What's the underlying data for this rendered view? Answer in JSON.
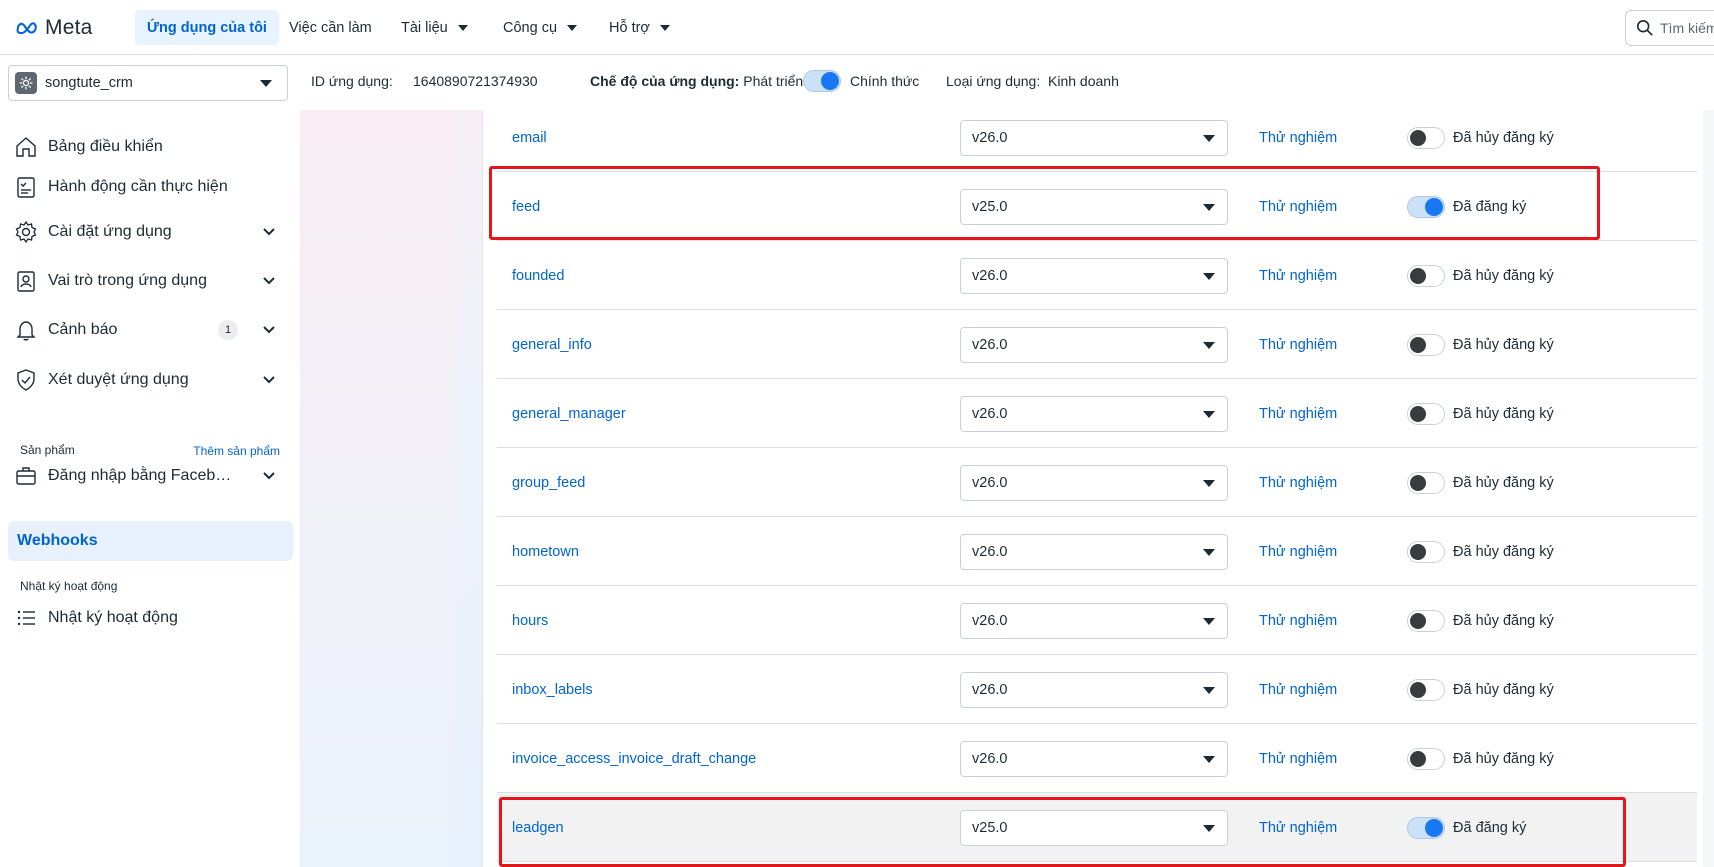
{
  "brand": {
    "name": "Meta"
  },
  "topnav": {
    "tabs": [
      {
        "label": "Ứng dụng của tôi",
        "active": true,
        "dropdown": false
      },
      {
        "label": "Việc cần làm",
        "active": false,
        "dropdown": false
      },
      {
        "label": "Tài liệu",
        "active": false,
        "dropdown": true
      },
      {
        "label": "Công cụ",
        "active": false,
        "dropdown": true
      },
      {
        "label": "Hỗ trợ",
        "active": false,
        "dropdown": true
      }
    ],
    "search_placeholder": "Tìm kiếm"
  },
  "appbar": {
    "app_name": "songtute_crm",
    "app_id_label": "ID ứng dụng:",
    "app_id": "1640890721374930",
    "mode_label": "Chế độ của ứng dụng:",
    "mode_dev": "Phát triển",
    "mode_live": "Chính thức",
    "mode_live_on": true,
    "type_label": "Loại ứng dụng:",
    "type_value": "Kinh doanh"
  },
  "sidebar": {
    "items": [
      {
        "label": "Bảng điều khiển",
        "icon": "home-icon"
      },
      {
        "label": "Hành động cần thực hiện",
        "icon": "checklist-icon"
      },
      {
        "label": "Cài đặt ứng dụng",
        "icon": "gear-icon"
      },
      {
        "label": "Vai trò trong ứng dụng",
        "icon": "id-badge-icon"
      },
      {
        "label": "Cảnh báo",
        "icon": "bell-icon",
        "badge": "1"
      },
      {
        "label": "Xét duyệt ứng dụng",
        "icon": "shield-check-icon"
      }
    ],
    "products_heading": "Sản phẩm",
    "add_product": "Thêm sản phẩm",
    "product_item": "Đăng nhập bằng Faceb…",
    "webhooks": "Webhooks",
    "activity_heading": "Nhật ký hoạt động",
    "activity_item": "Nhật ký hoạt động"
  },
  "fields": [
    {
      "name": "email",
      "version": "v26.0",
      "test": "Thử nghiệm",
      "subscribed": false,
      "status": "Đã hủy đăng ký"
    },
    {
      "name": "feed",
      "version": "v25.0",
      "test": "Thử nghiệm",
      "subscribed": true,
      "status": "Đã đăng ký"
    },
    {
      "name": "founded",
      "version": "v26.0",
      "test": "Thử nghiệm",
      "subscribed": false,
      "status": "Đã hủy đăng ký"
    },
    {
      "name": "general_info",
      "version": "v26.0",
      "test": "Thử nghiệm",
      "subscribed": false,
      "status": "Đã hủy đăng ký"
    },
    {
      "name": "general_manager",
      "version": "v26.0",
      "test": "Thử nghiệm",
      "subscribed": false,
      "status": "Đã hủy đăng ký"
    },
    {
      "name": "group_feed",
      "version": "v26.0",
      "test": "Thử nghiệm",
      "subscribed": false,
      "status": "Đã hủy đăng ký"
    },
    {
      "name": "hometown",
      "version": "v26.0",
      "test": "Thử nghiệm",
      "subscribed": false,
      "status": "Đã hủy đăng ký"
    },
    {
      "name": "hours",
      "version": "v26.0",
      "test": "Thử nghiệm",
      "subscribed": false,
      "status": "Đã hủy đăng ký"
    },
    {
      "name": "inbox_labels",
      "version": "v26.0",
      "test": "Thử nghiệm",
      "subscribed": false,
      "status": "Đã hủy đăng ký"
    },
    {
      "name": "invoice_access_invoice_draft_change",
      "version": "v26.0",
      "test": "Thử nghiệm",
      "subscribed": false,
      "status": "Đã hủy đăng ký"
    },
    {
      "name": "leadgen",
      "version": "v25.0",
      "test": "Thử nghiệm",
      "subscribed": true,
      "status": "Đã đăng ký"
    }
  ],
  "colors": {
    "accent": "#0064d1",
    "toggle_on": "#1877f2",
    "highlight_box": "#e4161b"
  }
}
